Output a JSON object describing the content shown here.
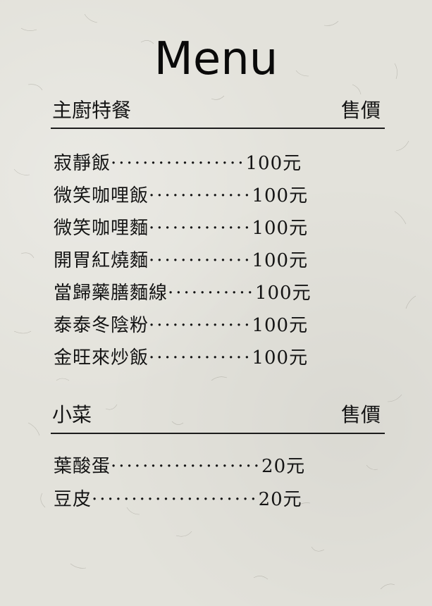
{
  "title": "Menu",
  "sections": [
    {
      "heading": "主廚特餐",
      "price_heading": "售價",
      "items": [
        {
          "name": "寂靜飯",
          "dots": "·················",
          "price": "100元"
        },
        {
          "name": "微笑咖哩飯",
          "dots": "·············",
          "price": "100元"
        },
        {
          "name": "微笑咖哩麵",
          "dots": "·············",
          "price": "100元"
        },
        {
          "name": "開胃紅燒麵",
          "dots": "·············",
          "price": "100元"
        },
        {
          "name": "當歸藥膳麵線",
          "dots": "···········",
          "price": "100元"
        },
        {
          "name": "泰泰冬陰粉",
          "dots": "·············",
          "price": "100元"
        },
        {
          "name": "金旺來炒飯",
          "dots": "·············",
          "price": "100元"
        }
      ]
    },
    {
      "heading": "小菜",
      "price_heading": "售價",
      "items": [
        {
          "name": "葉酸蛋",
          "dots": "···················",
          "price": "20元"
        },
        {
          "name": "豆皮",
          "dots": "·····················",
          "price": "20元"
        }
      ]
    }
  ]
}
